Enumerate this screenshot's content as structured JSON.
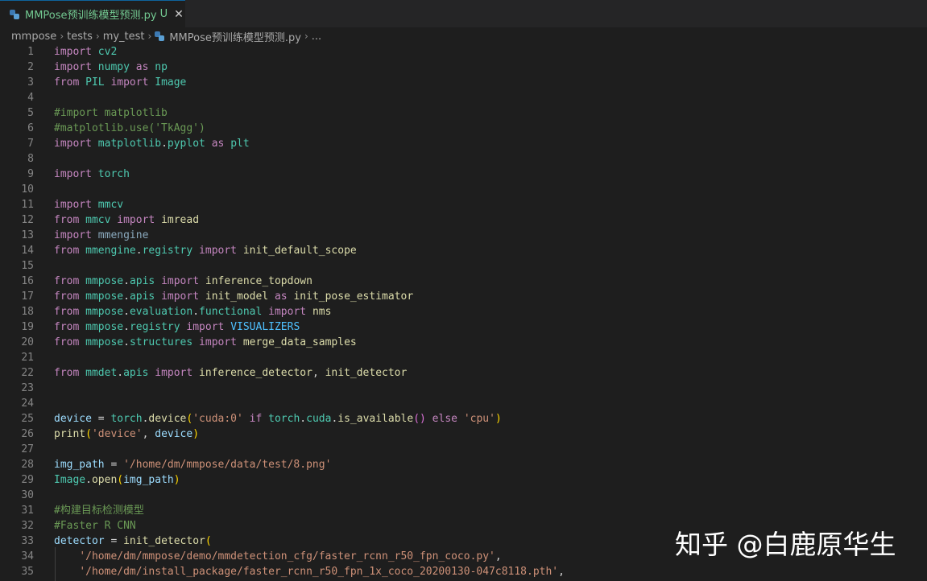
{
  "tab": {
    "title": "MMPose预训练模型预测.py",
    "status": "U",
    "close": "✕"
  },
  "breadcrumb": {
    "items": [
      "mmpose",
      "tests",
      "my_test",
      "MMPose预训练模型预测.py",
      "..."
    ],
    "sep": "›"
  },
  "editor": {
    "lines": [
      {
        "n": "1",
        "tokens": [
          [
            "kw",
            "import"
          ],
          [
            "pu",
            " "
          ],
          [
            "mod",
            "cv2"
          ]
        ]
      },
      {
        "n": "2",
        "tokens": [
          [
            "kw",
            "import"
          ],
          [
            "pu",
            " "
          ],
          [
            "mod",
            "numpy"
          ],
          [
            "pu",
            " "
          ],
          [
            "kw",
            "as"
          ],
          [
            "pu",
            " "
          ],
          [
            "mod",
            "np"
          ]
        ]
      },
      {
        "n": "3",
        "tokens": [
          [
            "kw",
            "from"
          ],
          [
            "pu",
            " "
          ],
          [
            "mod",
            "PIL"
          ],
          [
            "pu",
            " "
          ],
          [
            "kw",
            "import"
          ],
          [
            "pu",
            " "
          ],
          [
            "mod",
            "Image"
          ]
        ]
      },
      {
        "n": "4",
        "tokens": []
      },
      {
        "n": "5",
        "tokens": [
          [
            "cm",
            "#import matplotlib"
          ]
        ]
      },
      {
        "n": "6",
        "tokens": [
          [
            "cm",
            "#matplotlib.use('TkAgg')"
          ]
        ]
      },
      {
        "n": "7",
        "tokens": [
          [
            "kw",
            "import"
          ],
          [
            "pu",
            " "
          ],
          [
            "mod",
            "matplotlib"
          ],
          [
            "pu",
            "."
          ],
          [
            "mod",
            "pyplot"
          ],
          [
            "pu",
            " "
          ],
          [
            "kw",
            "as"
          ],
          [
            "pu",
            " "
          ],
          [
            "mod",
            "plt"
          ]
        ]
      },
      {
        "n": "8",
        "tokens": []
      },
      {
        "n": "9",
        "tokens": [
          [
            "kw",
            "import"
          ],
          [
            "pu",
            " "
          ],
          [
            "mod",
            "torch"
          ]
        ]
      },
      {
        "n": "10",
        "tokens": []
      },
      {
        "n": "11",
        "tokens": [
          [
            "kw",
            "import"
          ],
          [
            "pu",
            " "
          ],
          [
            "mod",
            "mmcv"
          ]
        ]
      },
      {
        "n": "12",
        "tokens": [
          [
            "kw",
            "from"
          ],
          [
            "pu",
            " "
          ],
          [
            "mod",
            "mmcv"
          ],
          [
            "pu",
            " "
          ],
          [
            "kw",
            "import"
          ],
          [
            "pu",
            " "
          ],
          [
            "fn",
            "imread"
          ]
        ]
      },
      {
        "n": "13",
        "tokens": [
          [
            "kw",
            "import"
          ],
          [
            "pu",
            " "
          ],
          [
            "faint",
            "mmengine"
          ]
        ]
      },
      {
        "n": "14",
        "tokens": [
          [
            "kw",
            "from"
          ],
          [
            "pu",
            " "
          ],
          [
            "mod",
            "mmengine"
          ],
          [
            "pu",
            "."
          ],
          [
            "mod",
            "registry"
          ],
          [
            "pu",
            " "
          ],
          [
            "kw",
            "import"
          ],
          [
            "pu",
            " "
          ],
          [
            "fn",
            "init_default_scope"
          ]
        ]
      },
      {
        "n": "15",
        "tokens": []
      },
      {
        "n": "16",
        "tokens": [
          [
            "kw",
            "from"
          ],
          [
            "pu",
            " "
          ],
          [
            "mod",
            "mmpose"
          ],
          [
            "pu",
            "."
          ],
          [
            "mod",
            "apis"
          ],
          [
            "pu",
            " "
          ],
          [
            "kw",
            "import"
          ],
          [
            "pu",
            " "
          ],
          [
            "fn",
            "inference_topdown"
          ]
        ]
      },
      {
        "n": "17",
        "tokens": [
          [
            "kw",
            "from"
          ],
          [
            "pu",
            " "
          ],
          [
            "mod",
            "mmpose"
          ],
          [
            "pu",
            "."
          ],
          [
            "mod",
            "apis"
          ],
          [
            "pu",
            " "
          ],
          [
            "kw",
            "import"
          ],
          [
            "pu",
            " "
          ],
          [
            "fn",
            "init_model"
          ],
          [
            "pu",
            " "
          ],
          [
            "kw",
            "as"
          ],
          [
            "pu",
            " "
          ],
          [
            "fn",
            "init_pose_estimator"
          ]
        ]
      },
      {
        "n": "18",
        "tokens": [
          [
            "kw",
            "from"
          ],
          [
            "pu",
            " "
          ],
          [
            "mod",
            "mmpose"
          ],
          [
            "pu",
            "."
          ],
          [
            "mod",
            "evaluation"
          ],
          [
            "pu",
            "."
          ],
          [
            "mod",
            "functional"
          ],
          [
            "pu",
            " "
          ],
          [
            "kw",
            "import"
          ],
          [
            "pu",
            " "
          ],
          [
            "fn",
            "nms"
          ]
        ]
      },
      {
        "n": "19",
        "tokens": [
          [
            "kw",
            "from"
          ],
          [
            "pu",
            " "
          ],
          [
            "mod",
            "mmpose"
          ],
          [
            "pu",
            "."
          ],
          [
            "mod",
            "registry"
          ],
          [
            "pu",
            " "
          ],
          [
            "kw",
            "import"
          ],
          [
            "pu",
            " "
          ],
          [
            "const",
            "VISUALIZERS"
          ]
        ]
      },
      {
        "n": "20",
        "tokens": [
          [
            "kw",
            "from"
          ],
          [
            "pu",
            " "
          ],
          [
            "mod",
            "mmpose"
          ],
          [
            "pu",
            "."
          ],
          [
            "mod",
            "structures"
          ],
          [
            "pu",
            " "
          ],
          [
            "kw",
            "import"
          ],
          [
            "pu",
            " "
          ],
          [
            "fn",
            "merge_data_samples"
          ]
        ]
      },
      {
        "n": "21",
        "tokens": []
      },
      {
        "n": "22",
        "tokens": [
          [
            "kw",
            "from"
          ],
          [
            "pu",
            " "
          ],
          [
            "mod",
            "mmdet"
          ],
          [
            "pu",
            "."
          ],
          [
            "mod",
            "apis"
          ],
          [
            "pu",
            " "
          ],
          [
            "kw",
            "import"
          ],
          [
            "pu",
            " "
          ],
          [
            "fn",
            "inference_detector"
          ],
          [
            "pu",
            ", "
          ],
          [
            "fn",
            "init_detector"
          ]
        ]
      },
      {
        "n": "23",
        "tokens": []
      },
      {
        "n": "24",
        "tokens": []
      },
      {
        "n": "25",
        "tokens": [
          [
            "var",
            "device"
          ],
          [
            "pu",
            " = "
          ],
          [
            "mod",
            "torch"
          ],
          [
            "pu",
            "."
          ],
          [
            "fn",
            "device"
          ],
          [
            "br",
            "("
          ],
          [
            "str",
            "'cuda:0'"
          ],
          [
            "pu",
            " "
          ],
          [
            "kw",
            "if"
          ],
          [
            "pu",
            " "
          ],
          [
            "mod",
            "torch"
          ],
          [
            "pu",
            "."
          ],
          [
            "mod",
            "cuda"
          ],
          [
            "pu",
            "."
          ],
          [
            "fn",
            "is_available"
          ],
          [
            "br2",
            "()"
          ],
          [
            "pu",
            " "
          ],
          [
            "kw",
            "else"
          ],
          [
            "pu",
            " "
          ],
          [
            "str",
            "'cpu'"
          ],
          [
            "br",
            ")"
          ]
        ]
      },
      {
        "n": "26",
        "tokens": [
          [
            "fn",
            "print"
          ],
          [
            "br",
            "("
          ],
          [
            "str",
            "'device'"
          ],
          [
            "pu",
            ", "
          ],
          [
            "var",
            "device"
          ],
          [
            "br",
            ")"
          ]
        ]
      },
      {
        "n": "27",
        "tokens": []
      },
      {
        "n": "28",
        "tokens": [
          [
            "var",
            "img_path"
          ],
          [
            "pu",
            " = "
          ],
          [
            "str",
            "'/home/dm/mmpose/data/test/8.png'"
          ]
        ]
      },
      {
        "n": "29",
        "tokens": [
          [
            "mod",
            "Image"
          ],
          [
            "pu",
            "."
          ],
          [
            "fn",
            "open"
          ],
          [
            "br",
            "("
          ],
          [
            "var",
            "img_path"
          ],
          [
            "br",
            ")"
          ]
        ]
      },
      {
        "n": "30",
        "tokens": []
      },
      {
        "n": "31",
        "tokens": [
          [
            "cm",
            "#构建目标检测模型"
          ]
        ]
      },
      {
        "n": "32",
        "tokens": [
          [
            "cm",
            "#Faster R CNN"
          ]
        ]
      },
      {
        "n": "33",
        "tokens": [
          [
            "var",
            "detector"
          ],
          [
            "pu",
            " = "
          ],
          [
            "fn",
            "init_detector"
          ],
          [
            "br",
            "("
          ]
        ]
      },
      {
        "n": "34",
        "tokens": [
          [
            "pu",
            "    "
          ],
          [
            "str",
            "'/home/dm/mmpose/demo/mmdetection_cfg/faster_rcnn_r50_fpn_coco.py'"
          ],
          [
            "pu",
            ","
          ]
        ]
      },
      {
        "n": "35",
        "tokens": [
          [
            "pu",
            "    "
          ],
          [
            "str",
            "'/home/dm/install_package/faster_rcnn_r50_fpn_1x_coco_20200130-047c8118.pth'"
          ],
          [
            "pu",
            ","
          ]
        ]
      }
    ]
  },
  "watermark": "知乎 @白鹿原华生"
}
